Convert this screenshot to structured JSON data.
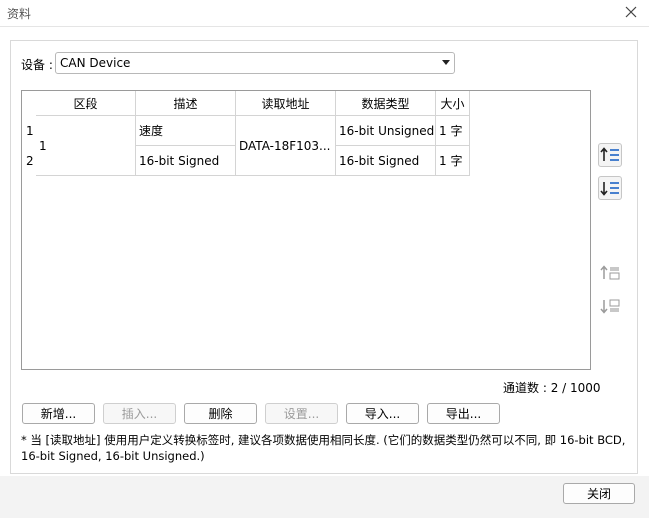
{
  "window": {
    "title": "资料",
    "close_icon": "close-icon"
  },
  "device": {
    "label": "设备 :",
    "selected": "CAN Device"
  },
  "table": {
    "columns": [
      "区段",
      "描述",
      "读取地址",
      "数据类型",
      "大小"
    ],
    "row_numbers": [
      "1",
      "2"
    ],
    "segment": "1",
    "read_address": "DATA-18F103...",
    "rows": [
      {
        "description": "速度",
        "data_type": "16-bit Unsigned",
        "size": "1 字"
      },
      {
        "description": "16-bit Signed",
        "data_type": "16-bit Signed",
        "size": "1 字"
      }
    ]
  },
  "side_buttons": {
    "move_up": "move-up-icon",
    "move_down": "move-down-icon",
    "move_top": "move-top-icon",
    "move_bottom": "move-bottom-icon"
  },
  "channel_count": {
    "label": "通道数 :",
    "value": "2 / 1000"
  },
  "buttons": {
    "new": "新增...",
    "insert": "插入...",
    "delete": "删除",
    "settings": "设置...",
    "import": "导入...",
    "export": "导出..."
  },
  "note": "* 当 [读取地址] 使用用户定义转换标签时, 建议各项数据使用相同长度. (它们的数据类型仍然可以不同, 即 16-bit BCD, 16-bit Signed, 16-bit Unsigned.)",
  "footer": {
    "close": "关闭"
  },
  "colors": {
    "accent": "#2f6fc9",
    "disabled_text": "#9b9b9b"
  }
}
